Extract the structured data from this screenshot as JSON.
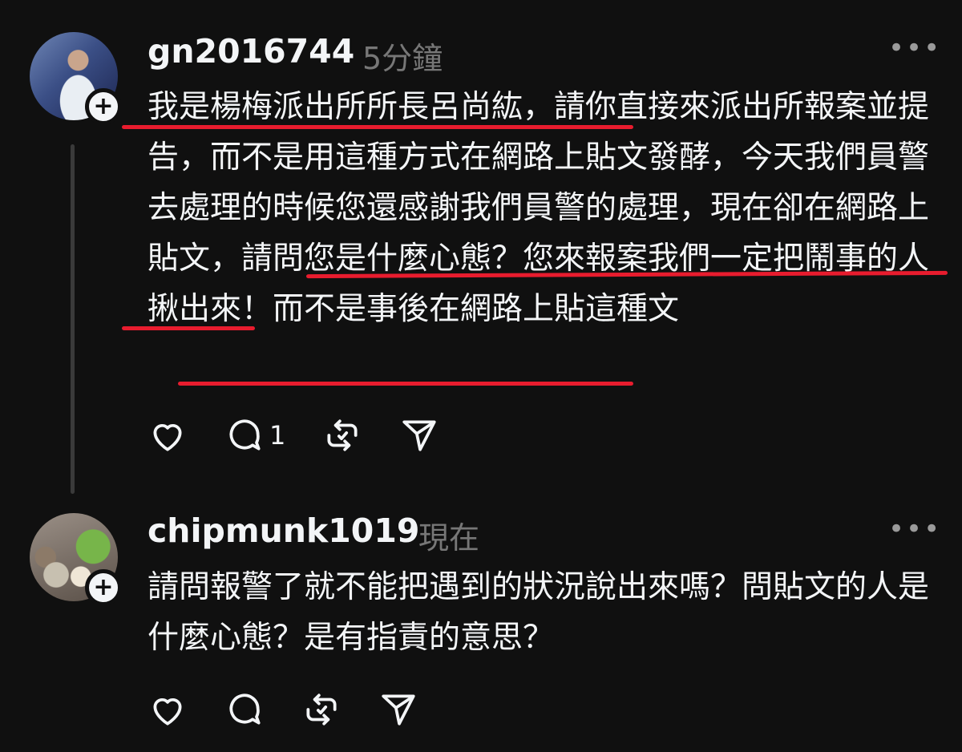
{
  "posts": [
    {
      "username": "gn2016744",
      "time": "5分鐘",
      "more": "•••",
      "text": "我是楊梅派出所所長呂尚紘，請你直接來派出所報案並提告，而不是用這種方式在網路上貼文發酵，今天我們員警去處理的時候您還感謝我們員警的處理，現在卻在網路上貼文，請問您是什麼心態？您來報案我們一定把鬧事的人揪出來！而不是事後在網路上貼這種文",
      "reply_count": "1"
    },
    {
      "username": "chipmunk1019",
      "time": "現在",
      "more": "•••",
      "text": "請問報警了就不能把遇到的狀況說出來嗎？問貼文的人是什麼心態？是有指責的意思？",
      "reply_count": ""
    }
  ],
  "icons": {
    "like": "heart-icon",
    "reply": "comment-icon",
    "repost": "repost-icon",
    "share": "send-icon",
    "follow": "plus-icon"
  },
  "colors": {
    "background": "#101010",
    "text": "#f3f5f7",
    "muted": "#777777",
    "underline": "#e81c2e"
  }
}
